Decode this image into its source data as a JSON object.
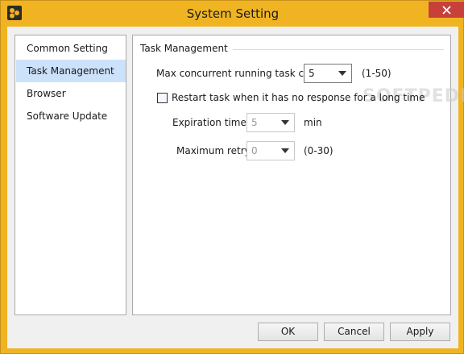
{
  "window": {
    "title": "System Setting"
  },
  "nav": {
    "items": [
      {
        "label": "Common Setting"
      },
      {
        "label": "Task Management"
      },
      {
        "label": "Browser"
      },
      {
        "label": "Software Update"
      }
    ],
    "selected": "Task Management"
  },
  "task_management": {
    "group_title": "Task Management",
    "max_concurrent": {
      "label": "Max concurrent running task count:",
      "value": "5",
      "range": "(1-50)"
    },
    "restart_task": {
      "label": "Restart task when it has no response for a long time",
      "checked": false
    },
    "expiration": {
      "label": "Expiration times:",
      "value": "5",
      "unit": "min"
    },
    "max_retry": {
      "label": "Maximum retry:",
      "value": "0",
      "range": "(0-30)"
    }
  },
  "watermark": "SOFTPEDIA",
  "buttons": {
    "ok": "OK",
    "cancel": "Cancel",
    "apply": "Apply"
  },
  "colors": {
    "frame": "#f0b422",
    "close": "#c7403a",
    "selection": "#cce1fa"
  }
}
